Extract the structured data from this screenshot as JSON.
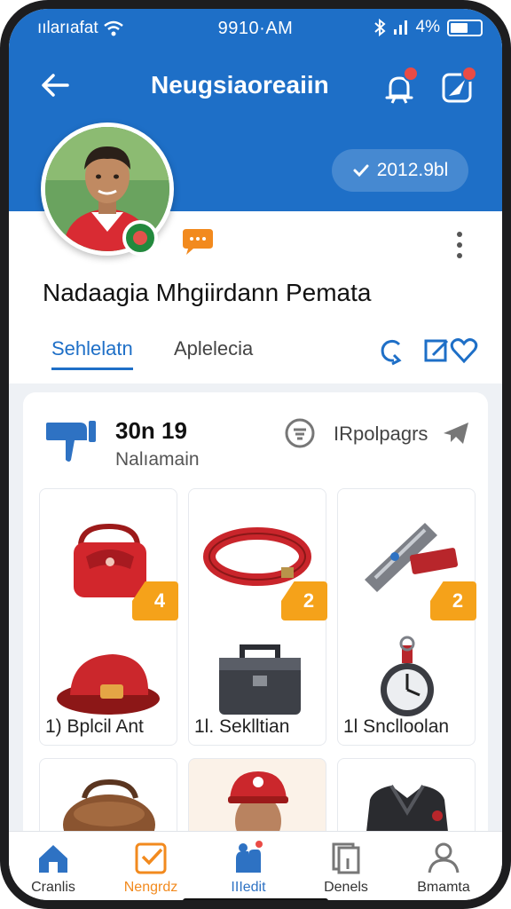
{
  "status_bar": {
    "carrier": "ıılarıafat",
    "time": "9910·AM",
    "battery_text": "4%",
    "battery_level": 0.6
  },
  "header": {
    "title": "Neugsiaoreaiin",
    "follow_label": "2012.9bl"
  },
  "profile": {
    "name": "Nadaagia Mhgiirdann Pemata"
  },
  "tabs": [
    {
      "label": "Sehlelatn",
      "active": true
    },
    {
      "label": "Aplelecia",
      "active": false
    }
  ],
  "stats": {
    "value": "30n 19",
    "label": "Nalıamain",
    "filter_label": "IRpolpagrs"
  },
  "items": [
    {
      "count": "4",
      "caption": "1) Bplcil Ant",
      "top_icon": "red-purse-icon",
      "bottom_icon": "red-hat-icon"
    },
    {
      "count": "2",
      "caption": "1l. Seklltian",
      "top_icon": "red-collar-icon",
      "bottom_icon": "toolbox-icon"
    },
    {
      "count": "2",
      "caption": "1l Snclloolan",
      "top_icon": "knife-icon",
      "bottom_icon": "stopwatch-icon"
    }
  ],
  "bottom_nav": [
    {
      "label": "Cranlis",
      "icon": "home-icon",
      "active": false
    },
    {
      "label": "Nengrdz",
      "icon": "calendar-check-icon",
      "active": true
    },
    {
      "label": "IIIedit",
      "icon": "person-badge-icon",
      "active": false
    },
    {
      "label": "Denels",
      "icon": "document-icon",
      "active": false
    },
    {
      "label": "Bmamta",
      "icon": "profile-icon",
      "active": false
    }
  ],
  "colors": {
    "primary": "#1e6fc7",
    "accent": "#f5a21a",
    "notification": "#ea4b45"
  }
}
